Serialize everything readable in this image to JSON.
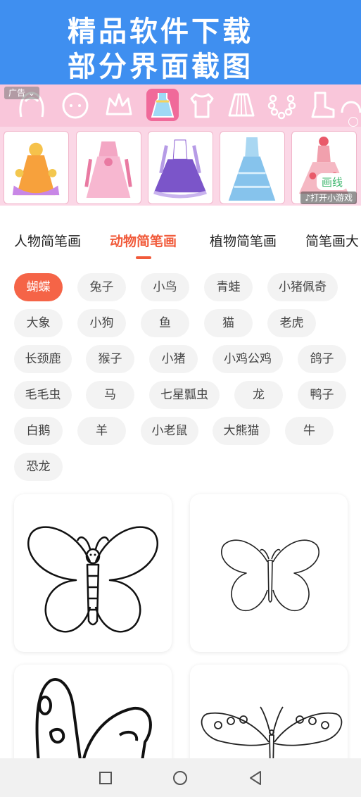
{
  "promo": {
    "line1": "精品软件下载",
    "line2": "部分界面截图"
  },
  "ad": {
    "tag": "广告 ⌄",
    "open_label": "♪打开小游戏",
    "logo_text": "画线",
    "categories": [
      "hair-icon",
      "face-icon",
      "crown-icon",
      "dress-icon",
      "shirt-icon",
      "skirt-icon",
      "necklace-icon",
      "boot-icon",
      "hat-icon"
    ]
  },
  "tabs": [
    {
      "label": "人物简笔画",
      "active": false
    },
    {
      "label": "动物简笔画",
      "active": true
    },
    {
      "label": "植物简笔画",
      "active": false
    },
    {
      "label": "简笔画大",
      "active": false
    }
  ],
  "chips": [
    "蝴蝶",
    "兔子",
    "小鸟",
    "青蛙",
    "小猪佩奇",
    "大象",
    "小狗",
    "鱼",
    "猫",
    "老虎",
    "长颈鹿",
    "猴子",
    "小猪",
    "小鸡公鸡",
    "鸽子",
    "毛毛虫",
    "马",
    "七星瓢虫",
    "龙",
    "鸭子",
    "白鹅",
    "羊",
    "小老鼠",
    "大熊猫",
    "牛",
    "恐龙"
  ],
  "active_chip": "蝴蝶",
  "colors": {
    "promo_bg": "#3f8ff0",
    "accent": "#f15a3a",
    "chip_active": "#f56447",
    "chip_bg": "#f3f3f3",
    "ad_bg": "#fbd7e6"
  },
  "nav": {
    "back_icon": "triangle-back-icon",
    "home_icon": "circle-home-icon",
    "recents_icon": "square-recents-icon"
  }
}
